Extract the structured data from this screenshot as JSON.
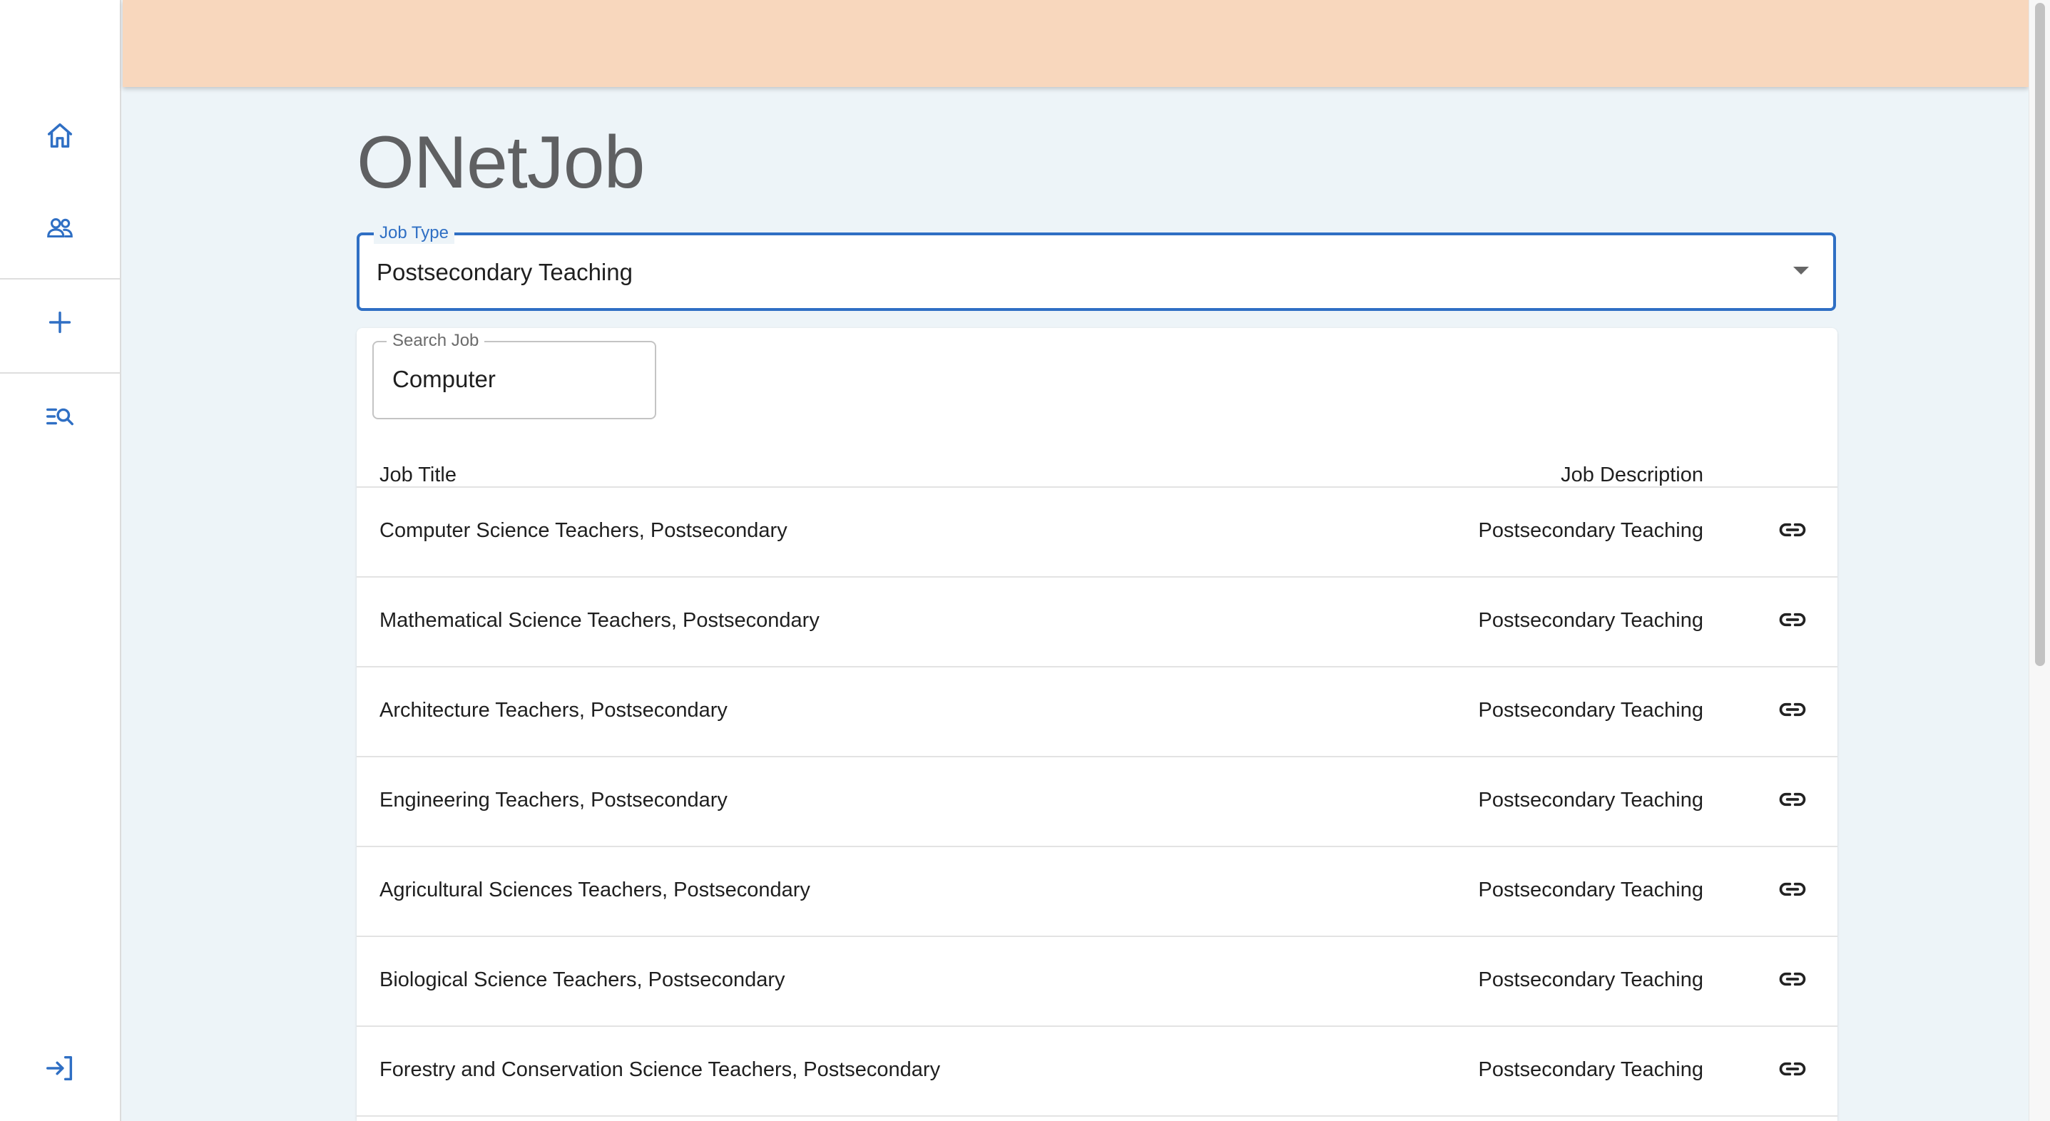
{
  "sidebar": {
    "items": [
      {
        "icon": "home-icon"
      },
      {
        "icon": "people-icon"
      },
      {
        "icon": "plus-icon"
      },
      {
        "icon": "search-list-icon"
      },
      {
        "icon": "login-icon"
      }
    ],
    "icon_color": "#2f6fc4"
  },
  "header": {
    "background": "#f8d7bd"
  },
  "main": {
    "title": "ONetJob",
    "job_type": {
      "label": "Job Type",
      "value": "Postsecondary Teaching"
    },
    "search": {
      "label": "Search Job",
      "value": "Computer"
    },
    "table": {
      "columns": [
        "Job Title",
        "Job Description"
      ],
      "rows": [
        {
          "title": "Computer Science Teachers, Postsecondary",
          "description": "Postsecondary Teaching",
          "icon": "link-icon"
        },
        {
          "title": "Mathematical Science Teachers, Postsecondary",
          "description": "Postsecondary Teaching",
          "icon": "link-icon"
        },
        {
          "title": "Architecture Teachers, Postsecondary",
          "description": "Postsecondary Teaching",
          "icon": "link-icon"
        },
        {
          "title": "Engineering Teachers, Postsecondary",
          "description": "Postsecondary Teaching",
          "icon": "link-icon"
        },
        {
          "title": "Agricultural Sciences Teachers, Postsecondary",
          "description": "Postsecondary Teaching",
          "icon": "link-icon"
        },
        {
          "title": "Biological Science Teachers, Postsecondary",
          "description": "Postsecondary Teaching",
          "icon": "link-icon"
        },
        {
          "title": "Forestry and Conservation Science Teachers, Postsecondary",
          "description": "Postsecondary Teaching",
          "icon": "link-icon"
        }
      ]
    }
  },
  "colors": {
    "accent": "#2f6fc4",
    "background": "#edf4f8"
  }
}
